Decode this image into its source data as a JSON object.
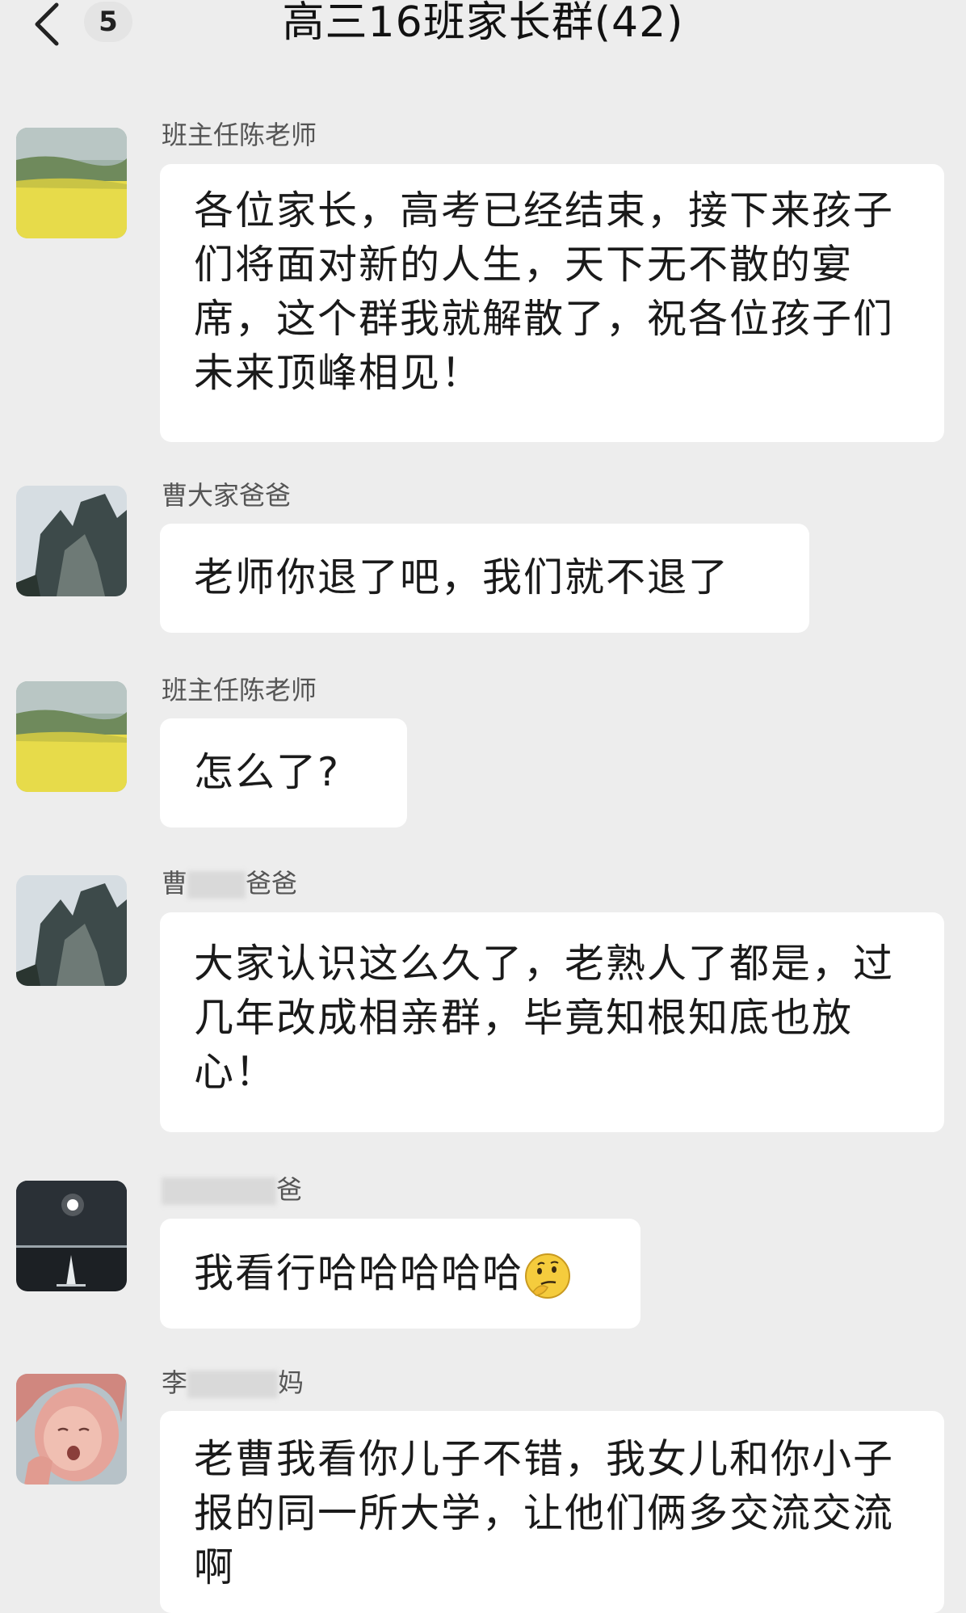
{
  "header": {
    "unread_count": "5",
    "title": "高三16班家长群(42)"
  },
  "messages": [
    {
      "sender": "班主任陈老师",
      "avatar": "landscape-field-avatar",
      "text": "各位家长，高考已经结束，接下来孩子们将面对新的人生，天下无不散的宴席，这个群我就解散了，祝各位孩子们未来顶峰相见！"
    },
    {
      "sender": "曹大家爸爸",
      "avatar": "rock-cliff-avatar",
      "text": "老师你退了吧，我们就不退了"
    },
    {
      "sender": "班主任陈老师",
      "avatar": "landscape-field-avatar",
      "text": "怎么了?"
    },
    {
      "sender_visible_start": "曹",
      "sender_visible_end": "爸爸",
      "avatar": "rock-cliff-avatar",
      "text": "大家认识这么久了，老熟人了都是，过几年改成相亲群，毕竟知根知底也放心！"
    },
    {
      "sender_visible_end": "爸",
      "avatar": "moon-sea-avatar",
      "text": "我看行哈哈哈哈哈",
      "emoji": "thinking-face-emoji"
    },
    {
      "sender_visible_start": "李",
      "sender_visible_end": "妈",
      "avatar": "baby-photo-avatar",
      "text": "老曹我看你儿子不错，我女儿和你小子报的同一所大学，让他们俩多交流交流啊"
    }
  ]
}
